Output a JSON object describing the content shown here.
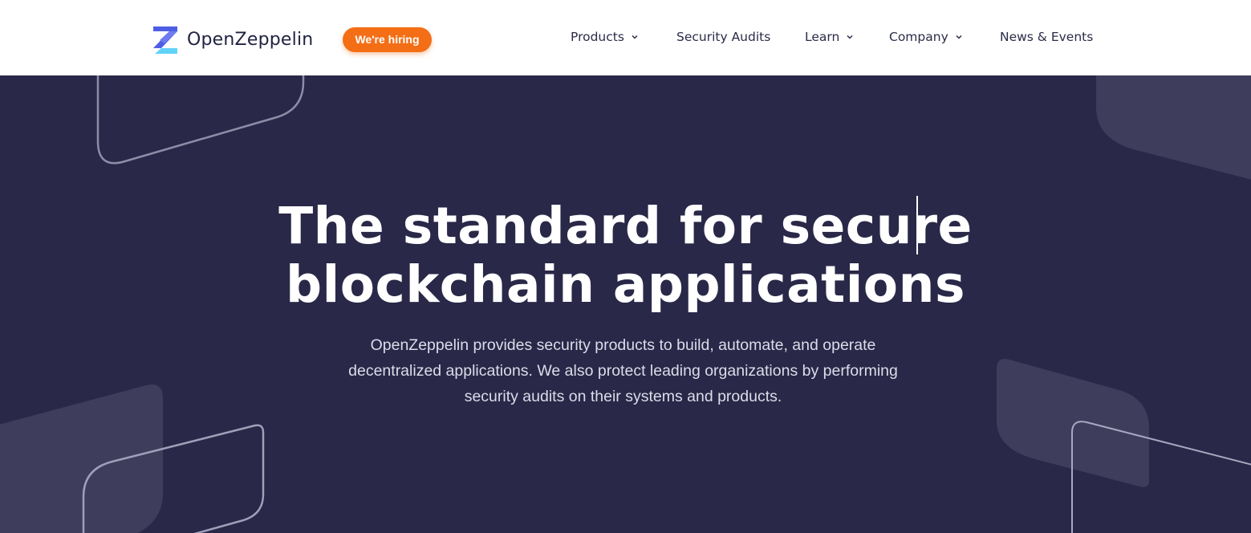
{
  "header": {
    "logo_text": "OpenZeppelin",
    "hiring_badge": "We're hiring",
    "nav": [
      {
        "label": "Products",
        "has_dropdown": true
      },
      {
        "label": "Security Audits",
        "has_dropdown": false
      },
      {
        "label": "Learn",
        "has_dropdown": true
      },
      {
        "label": "Company",
        "has_dropdown": true
      },
      {
        "label": "News & Events",
        "has_dropdown": false
      }
    ]
  },
  "hero": {
    "title_line1": "The standard for secure",
    "title_line2": "blockchain applications",
    "subtitle_line1": "OpenZeppelin provides security products to build, automate, and operate",
    "subtitle_line2": "decentralized applications. We also protect leading organizations by performing",
    "subtitle_line3": "security audits on their systems and products."
  },
  "icons": {
    "logo": "openzeppelin-logo-icon",
    "dropdown": "chevron-down-icon"
  },
  "colors": {
    "hero_background": "#292848",
    "accent_orange": "#f46e16",
    "logo_blue": "#4e5ee4",
    "logo_cyan": "#63d2f9",
    "nav_text": "#2a2c48"
  }
}
